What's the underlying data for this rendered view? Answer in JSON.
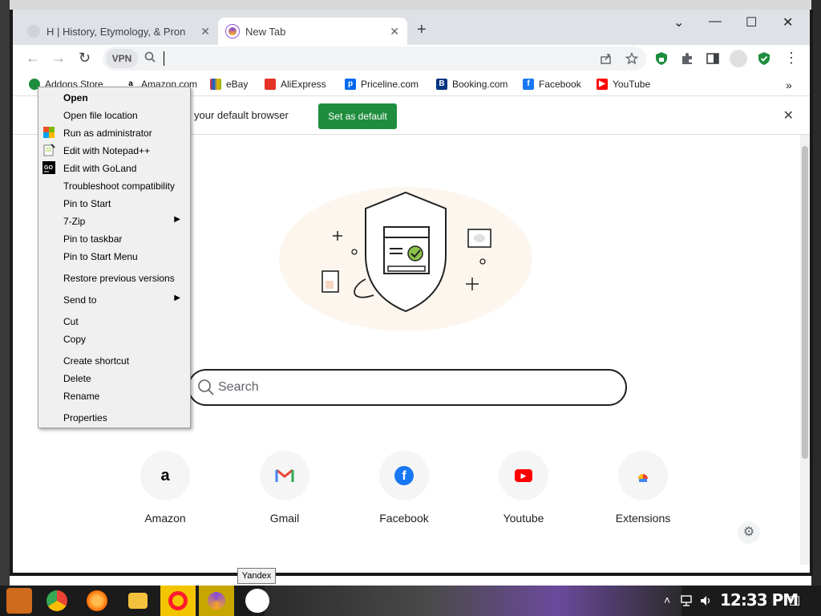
{
  "browser": {
    "tabs": [
      {
        "title": "H | History, Etymology, & Pron",
        "active": false
      },
      {
        "title": "New Tab",
        "active": true
      }
    ],
    "new_tab_symbol": "+",
    "window_controls": {
      "minimize": "—",
      "maximize": "☐",
      "close": "✕",
      "tab_search": "⌄"
    },
    "toolbar": {
      "back": "←",
      "forward": "→",
      "reload": "↻",
      "vpn_label": "VPN",
      "address_value": "",
      "menu": "⋮"
    },
    "bookmarks": [
      {
        "label": "Addons Store",
        "icon": "addons-icon"
      },
      {
        "label": "Amazon.com",
        "icon": "amazon-icon"
      },
      {
        "label": "eBay",
        "icon": "ebay-icon"
      },
      {
        "label": "AliExpress",
        "icon": "aliexpress-icon"
      },
      {
        "label": "Priceline.com",
        "icon": "priceline-icon"
      },
      {
        "label": "Booking.com",
        "icon": "booking-icon"
      },
      {
        "label": "Facebook",
        "icon": "facebook-icon"
      },
      {
        "label": "YouTube",
        "icon": "youtube-icon"
      }
    ],
    "bookmarks_overflow": "»",
    "infobar": {
      "text": "your default browser",
      "button": "Set as default",
      "close": "✕"
    }
  },
  "newtab": {
    "search_placeholder": "Search",
    "tiles": [
      {
        "label": "Amazon",
        "icon": "amazon-icon"
      },
      {
        "label": "Gmail",
        "icon": "gmail-icon"
      },
      {
        "label": "Facebook",
        "icon": "facebook-icon"
      },
      {
        "label": "Youtube",
        "icon": "youtube-icon"
      },
      {
        "label": "Extensions",
        "icon": "extensions-icon"
      }
    ],
    "settings_icon": "⚙"
  },
  "context_menu": {
    "items": [
      {
        "label": "Open",
        "bold": true
      },
      {
        "label": "Open file location"
      },
      {
        "label": "Run as administrator",
        "icon": "shield-icon"
      },
      {
        "label": "Edit with Notepad++",
        "icon": "notepad-icon"
      },
      {
        "label": "Edit with GoLand",
        "icon": "goland-icon"
      },
      {
        "label": "Troubleshoot compatibility"
      },
      {
        "label": "Pin to Start"
      },
      {
        "label": "7-Zip",
        "submenu": true
      },
      {
        "label": "Pin to taskbar"
      },
      {
        "label": "Pin to Start Menu"
      },
      {
        "label": "Restore previous versions"
      },
      {
        "label": "Send to",
        "submenu": true
      },
      {
        "label": "Cut"
      },
      {
        "label": "Copy"
      },
      {
        "label": "Create shortcut"
      },
      {
        "label": "Delete"
      },
      {
        "label": "Rename"
      },
      {
        "label": "Properties"
      }
    ],
    "submenu_arrow": "▶"
  },
  "tooltip": "Yandex",
  "taskbar": {
    "clock": "12:33 PM",
    "apps": [
      "start-icon",
      "chrome-icon",
      "firefox-icon",
      "file-explorer-icon",
      "opera-icon",
      "browser-icon",
      "app-icon"
    ],
    "tray_up": "˄",
    "notification": "☐"
  },
  "colors": {
    "accent_green": "#1e8e3e",
    "tab_strip": "#dee1e6",
    "menu_bg": "#f0f0f0"
  }
}
